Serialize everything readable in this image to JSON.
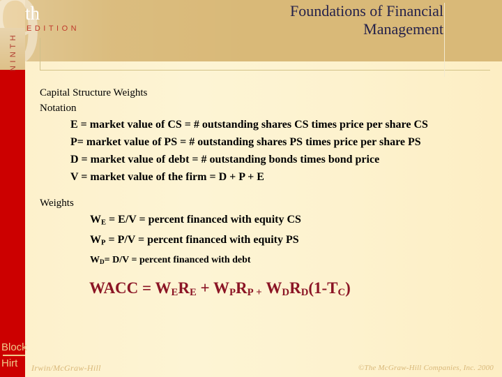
{
  "slide": {
    "edition": {
      "ordinal_suffix": "th",
      "edition_word": "EDITION",
      "ninth_word": "NINTH",
      "ghost_number": "9"
    },
    "title": "Foundations of Financial Management",
    "content": {
      "heading": "Capital Structure Weights",
      "subheading": "Notation",
      "notation_lines": [
        "E = market value of CS = # outstanding shares CS times price per share CS",
        "P= market value of  PS = # outstanding shares PS times price per share PS",
        "D = market value of debt = # outstanding bonds times bond price",
        "V = market value of the firm = D + P + E"
      ],
      "weights_label": "Weights",
      "weight_lines": [
        {
          "symbol": "W",
          "sub": "E",
          "text": " = E/V = percent financed with equity CS"
        },
        {
          "symbol": "W",
          "sub": "P",
          "text": " = P/V = percent financed with equity PS"
        },
        {
          "symbol": "W",
          "sub": "D",
          "text": "= D/V = percent financed with debt"
        }
      ],
      "wacc_formula": "WACC = WERE + WPRP + WDRD(1-TC)"
    },
    "footer": {
      "logo_line1": "Block",
      "logo_line2": "Hirt",
      "publisher": "Irwin/McGraw-Hill",
      "copyright": "©The McGraw-Hill Companies, Inc. 2000"
    },
    "colors": {
      "header_band": "#d9b978",
      "red_bar": "#cc0000",
      "title_text": "#24214a",
      "wacc_text": "#8b1525",
      "edition_text": "#c0392b",
      "footer_text": "#d9b87a",
      "background": "#fdf2cd"
    }
  }
}
